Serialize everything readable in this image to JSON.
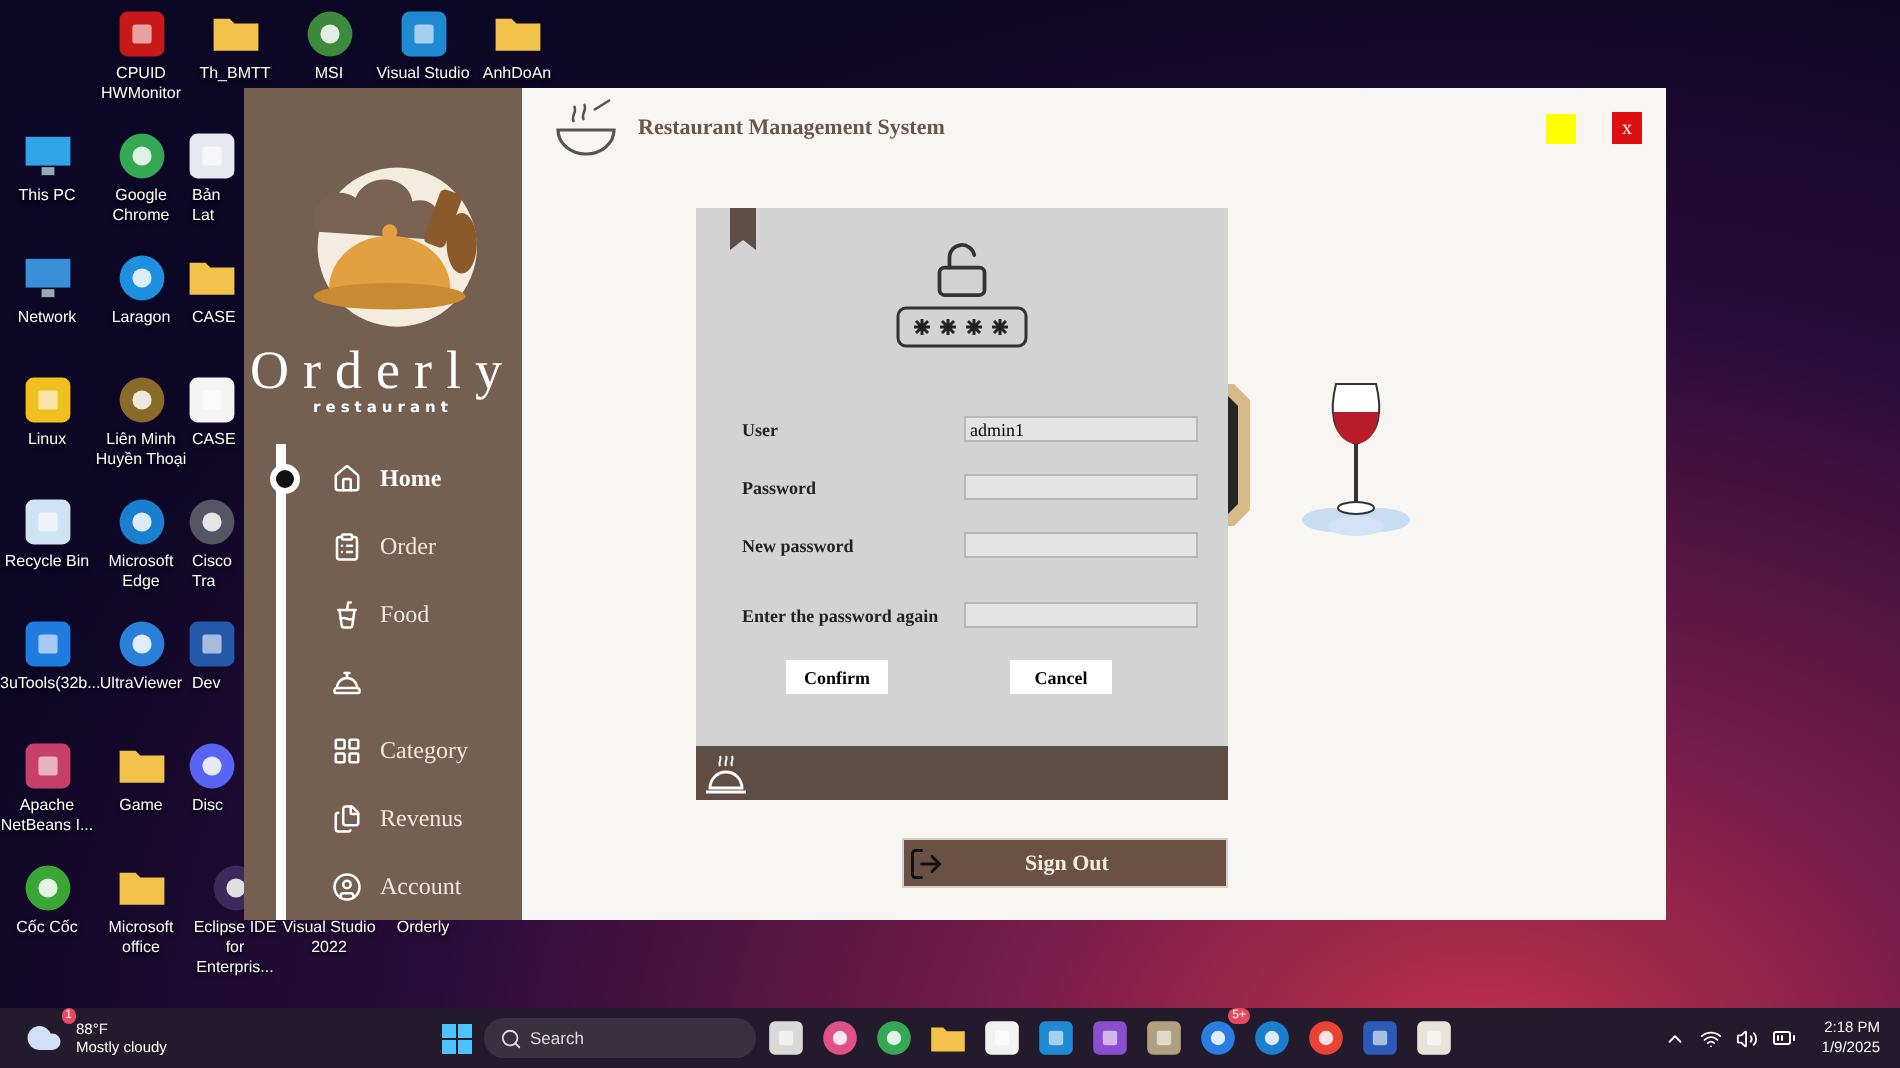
{
  "desktop": {
    "columns": [
      [
        {
          "label": "This PC",
          "kind": "monitor",
          "color": "#2fa4e7"
        },
        {
          "label": "Network",
          "kind": "monitor",
          "color": "#3b8fd8"
        },
        {
          "label": "Linux",
          "kind": "app",
          "color": "#f0c020"
        },
        {
          "label": "Recycle Bin",
          "kind": "app",
          "color": "#cfe3f2"
        },
        {
          "label": "3uTools(32b...",
          "kind": "app",
          "color": "#1e7be0"
        },
        {
          "label": "Apache NetBeans I...",
          "kind": "app",
          "color": "#c8406a"
        },
        {
          "label": "Cốc Cốc",
          "kind": "circle",
          "color": "#3aa635"
        }
      ],
      [
        {
          "label": "CPUID HWMonitor",
          "kind": "app",
          "color": "#c81818"
        },
        {
          "label": "Google Chrome",
          "kind": "circle",
          "color": "#34a853"
        },
        {
          "label": "Laragon",
          "kind": "circle",
          "color": "#1e90e0"
        },
        {
          "label": "Liên Minh Huyền Thoại",
          "kind": "circle",
          "color": "#8a6a2a"
        },
        {
          "label": "Microsoft Edge",
          "kind": "circle",
          "color": "#1b7fd0"
        },
        {
          "label": "UltraViewer",
          "kind": "circle",
          "color": "#2a80d8"
        },
        {
          "label": "Game",
          "kind": "folder",
          "color": "#f3c24a"
        },
        {
          "label": "Microsoft office",
          "kind": "folder",
          "color": "#f3c24a"
        }
      ],
      [
        {
          "label": "Th_BMTT",
          "kind": "folder",
          "color": "#f3c24a"
        },
        {
          "label": "Bản Lat",
          "kind": "app",
          "color": "#e8e8f0"
        },
        {
          "label": "CASE",
          "kind": "folder",
          "color": "#f3c24a"
        },
        {
          "label": "CASE",
          "kind": "app",
          "color": "#f4f4f4"
        },
        {
          "label": "Cisco Tra",
          "kind": "circle",
          "color": "#556"
        },
        {
          "label": "Dev",
          "kind": "app",
          "color": "#2458a8"
        },
        {
          "label": "Disc",
          "kind": "circle",
          "color": "#5865f2"
        },
        {
          "label": "Eclipse IDE for Enterpris...",
          "kind": "circle",
          "color": "#3b2a5a"
        }
      ],
      [
        {
          "label": "MSI",
          "kind": "circle",
          "color": "#3c8a3c"
        },
        {
          "label": "Visual Studio 2022"
        }
      ],
      [
        {
          "label": "Visual Studio",
          "kind": "app",
          "color": "#1f8ad2"
        },
        {
          "label": "Orderly"
        }
      ],
      [
        {
          "label": "AnhDoAn",
          "kind": "folder",
          "color": "#f3c24a"
        }
      ]
    ]
  },
  "app": {
    "title": "Restaurant Management System",
    "close_label": "x",
    "brand": {
      "name": "Orderly",
      "tagline": "restaurant"
    },
    "nav": [
      {
        "kind": "home",
        "label": "Home",
        "selected": true
      },
      {
        "kind": "order",
        "label": "Order",
        "selected": false
      },
      {
        "kind": "food",
        "label": "Food",
        "selected": false
      },
      {
        "kind": "table",
        "selected": false
      },
      {
        "kind": "category",
        "label": "Category",
        "selected": false
      },
      {
        "kind": "revenue",
        "label": "Revenus",
        "selected": false
      },
      {
        "kind": "account",
        "label": "Account",
        "selected": false
      }
    ],
    "sign_out": "Sign Out",
    "dialog": {
      "fields": [
        {
          "label": "User",
          "value": "admin1"
        },
        {
          "label": "Password"
        },
        {
          "label": "New password"
        },
        {
          "label": "Enter the password again"
        }
      ],
      "buttons": [
        "Confirm",
        "Cancel"
      ]
    }
  },
  "taskbar": {
    "weather": {
      "badge": "1",
      "temperature": "88°F",
      "condition": "Mostly cloudy"
    },
    "search": {
      "placeholder": "Search"
    },
    "pinned": [
      {
        "kind": "app",
        "color": "#d9d9d9"
      },
      {
        "kind": "circle",
        "color": "#e0508a"
      },
      {
        "kind": "circle",
        "color": "#34a853"
      },
      {
        "kind": "folder",
        "color": "#f3c24a"
      },
      {
        "kind": "app",
        "color": "#f2f2f2"
      },
      {
        "kind": "app",
        "color": "#1f8ad2"
      },
      {
        "kind": "app",
        "color": "#8a4fd0"
      },
      {
        "kind": "app",
        "color": "#b0a080"
      },
      {
        "kind": "circle",
        "color": "#2a7de1",
        "badge": "5+"
      },
      {
        "kind": "circle",
        "color": "#1b7fd0"
      },
      {
        "kind": "circle",
        "color": "#ea4335"
      },
      {
        "kind": "app",
        "color": "#2b5bb8"
      },
      {
        "kind": "app",
        "color": "#e8e4dc"
      }
    ],
    "time": "2:18 PM",
    "date": "1/9/2025"
  }
}
